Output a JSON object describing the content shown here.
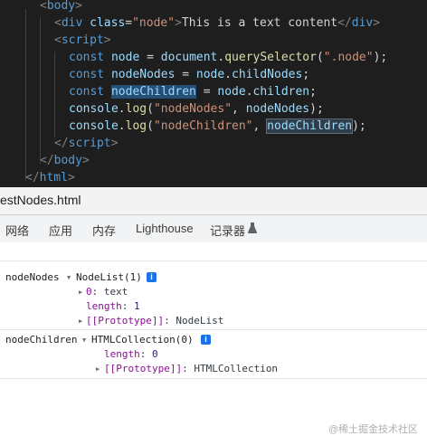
{
  "editor": {
    "lines": [
      {
        "tokens": [
          {
            "c": "tok-punct",
            "t": "<"
          },
          {
            "c": "tok-tag",
            "t": "body"
          },
          {
            "c": "tok-punct",
            "t": ">"
          }
        ]
      },
      {
        "tokens": [
          {
            "c": "tok-punct",
            "t": "<"
          },
          {
            "c": "tok-tag",
            "t": "div"
          },
          {
            "c": "tok-plain",
            "t": " "
          },
          {
            "c": "tok-attr",
            "t": "class"
          },
          {
            "c": "tok-plain",
            "t": "="
          },
          {
            "c": "tok-str",
            "t": "\"node\""
          },
          {
            "c": "tok-punct",
            "t": ">"
          },
          {
            "c": "tok-plain",
            "t": "This is a text content"
          },
          {
            "c": "tok-punct",
            "t": "</"
          },
          {
            "c": "tok-tag",
            "t": "div"
          },
          {
            "c": "tok-punct",
            "t": ">"
          }
        ]
      },
      {
        "tokens": [
          {
            "c": "tok-punct",
            "t": "<"
          },
          {
            "c": "tok-tag",
            "t": "script"
          },
          {
            "c": "tok-punct",
            "t": ">"
          }
        ]
      },
      {
        "tokens": [
          {
            "c": "tok-kw",
            "t": "const"
          },
          {
            "c": "tok-plain",
            "t": " "
          },
          {
            "c": "tok-var",
            "t": "node"
          },
          {
            "c": "tok-plain",
            "t": " = "
          },
          {
            "c": "tok-var",
            "t": "document"
          },
          {
            "c": "tok-plain",
            "t": "."
          },
          {
            "c": "tok-fn",
            "t": "querySelector"
          },
          {
            "c": "tok-plain",
            "t": "("
          },
          {
            "c": "tok-str",
            "t": "\".node\""
          },
          {
            "c": "tok-plain",
            "t": ");"
          }
        ]
      },
      {
        "tokens": [
          {
            "c": "tok-kw",
            "t": "const"
          },
          {
            "c": "tok-plain",
            "t": " "
          },
          {
            "c": "tok-var",
            "t": "nodeNodes"
          },
          {
            "c": "tok-plain",
            "t": " = "
          },
          {
            "c": "tok-var",
            "t": "node"
          },
          {
            "c": "tok-plain",
            "t": "."
          },
          {
            "c": "tok-var",
            "t": "childNodes"
          },
          {
            "c": "tok-plain",
            "t": ";"
          }
        ]
      },
      {
        "tokens": [
          {
            "c": "tok-kw",
            "t": "const"
          },
          {
            "c": "tok-plain",
            "t": " "
          },
          {
            "c": "tok-var hl-sel",
            "t": "nodeChildren"
          },
          {
            "c": "tok-plain",
            "t": " = "
          },
          {
            "c": "tok-var",
            "t": "node"
          },
          {
            "c": "tok-plain",
            "t": "."
          },
          {
            "c": "tok-var",
            "t": "children"
          },
          {
            "c": "tok-plain",
            "t": ";"
          }
        ]
      },
      {
        "tokens": [
          {
            "c": "tok-var",
            "t": "console"
          },
          {
            "c": "tok-plain",
            "t": "."
          },
          {
            "c": "tok-fn",
            "t": "log"
          },
          {
            "c": "tok-plain",
            "t": "("
          },
          {
            "c": "tok-str",
            "t": "\"nodeNodes\""
          },
          {
            "c": "tok-plain",
            "t": ", "
          },
          {
            "c": "tok-var",
            "t": "nodeNodes"
          },
          {
            "c": "tok-plain",
            "t": ");"
          }
        ]
      },
      {
        "tokens": [
          {
            "c": "tok-var",
            "t": "console"
          },
          {
            "c": "tok-plain",
            "t": "."
          },
          {
            "c": "tok-fn",
            "t": "log"
          },
          {
            "c": "tok-plain",
            "t": "("
          },
          {
            "c": "tok-str",
            "t": "\"nodeChildren\""
          },
          {
            "c": "tok-plain",
            "t": ", "
          },
          {
            "c": "tok-var hl-box",
            "t": "nodeChildren"
          },
          {
            "c": "tok-plain",
            "t": ");"
          }
        ]
      },
      {
        "tokens": [
          {
            "c": "tok-punct",
            "t": "</"
          },
          {
            "c": "tok-tag",
            "t": "script"
          },
          {
            "c": "tok-punct",
            "t": ">"
          }
        ]
      },
      {
        "tokens": [
          {
            "c": "tok-punct",
            "t": "</"
          },
          {
            "c": "tok-tag",
            "t": "body"
          },
          {
            "c": "tok-punct",
            "t": ">"
          }
        ]
      },
      {
        "tokens": [
          {
            "c": "tok-punct",
            "t": "</"
          },
          {
            "c": "tok-tag",
            "t": "html"
          },
          {
            "c": "tok-punct",
            "t": ">"
          }
        ]
      }
    ]
  },
  "file_tab": {
    "label": "estNodes.html"
  },
  "devtools_tabs": [
    {
      "label": "网络"
    },
    {
      "label": "应用"
    },
    {
      "label": "内存"
    },
    {
      "label": "Lighthouse"
    },
    {
      "label": "记录器"
    }
  ],
  "console": {
    "entry1": {
      "label": "nodeNodes",
      "summary": "NodeList(1)",
      "props": [
        {
          "key": "0",
          "value": "text"
        },
        {
          "key": "length",
          "value": "1"
        },
        {
          "key": "[[Prototype]]",
          "value": "NodeList"
        }
      ]
    },
    "entry2": {
      "label": "nodeChildren",
      "summary": "HTMLCollection(0)",
      "props": [
        {
          "key": "length",
          "value": "0"
        },
        {
          "key": "[[Prototype]]",
          "value": "HTMLCollection"
        }
      ]
    }
  },
  "watermark": "@稀土掘金技术社区",
  "colors": {
    "editor_bg": "#1e1e1e",
    "info_badge": "#1a73e8"
  }
}
